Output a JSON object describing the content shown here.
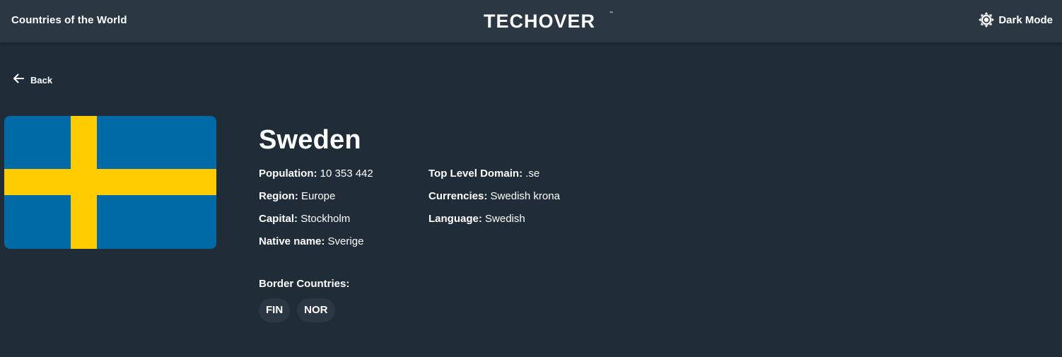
{
  "header": {
    "app_title": "Countries of the World",
    "logo_text": "TECHOVER",
    "logo_mark": "™",
    "theme_toggle": {
      "icon": "sun-gear-icon",
      "label": "Dark Mode"
    }
  },
  "nav": {
    "back_icon": "arrow-left-icon",
    "back_label": "Back"
  },
  "country": {
    "name": "Sweden",
    "flag": {
      "name": "sweden-flag",
      "blue": "#006aa7",
      "yellow": "#fecc00"
    },
    "primary_info": [
      {
        "key": "Population:",
        "value": "10 353 442"
      },
      {
        "key": "Region:",
        "value": "Europe"
      },
      {
        "key": "Capital:",
        "value": "Stockholm"
      },
      {
        "key": "Native name:",
        "value": "Sverige"
      }
    ],
    "secondary_info": [
      {
        "key": "Top Level Domain:",
        "value": ".se"
      },
      {
        "key": "Currencies:",
        "value": "Swedish krona"
      },
      {
        "key": "Language:",
        "value": "Swedish"
      }
    ],
    "border_label": "Border Countries:",
    "borders": [
      "FIN",
      "NOR"
    ]
  },
  "colors": {
    "background": "#202c37",
    "surface": "#2b3743",
    "text": "#ffffff"
  }
}
